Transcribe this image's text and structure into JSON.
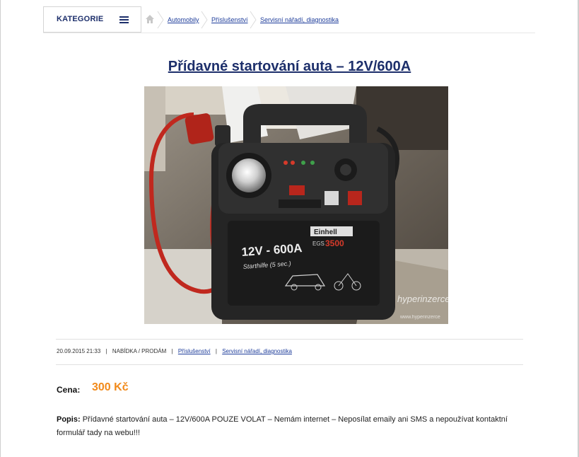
{
  "header": {
    "categories_label": "KATEGORIE",
    "breadcrumbs": [
      "Automobily",
      "Příslušenství",
      "Servisní nářadí, diagnostika"
    ]
  },
  "listing": {
    "title": "Přídavné startování auta – 12V/600A",
    "date": "20.09.2015 21:33",
    "type": "NABÍDKA / PRODÁM",
    "category_links": [
      "Příslušenství",
      "Servisní nářadí, diagnostika"
    ],
    "price_label": "Cena:",
    "price_value": "300 Kč",
    "description_label": "Popis:",
    "description_text": "Přídavné startování auta – 12V/600A POUZE VOLAT – Nemám internet – Neposílat emaily ani SMS a nepoužívat kontaktní formulář tady na webu!!!"
  },
  "photo": {
    "device_label": "12V - 600A",
    "device_sublabel": "Starthilfe (5 sec.)",
    "brand": "Einhell",
    "model_prefix": "EGS",
    "model_number": "3500",
    "watermark": "hyperinzerce",
    "watermark_url": "www.hyperinzerce"
  },
  "colors": {
    "brand_blue": "#1d2f6b",
    "link_blue": "#1d3c9a",
    "price_orange": "#f28a1a"
  }
}
